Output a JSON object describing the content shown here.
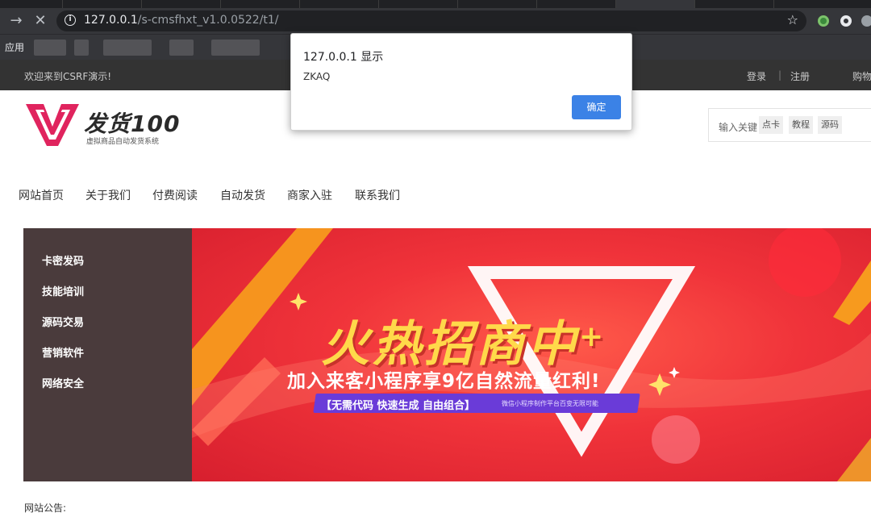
{
  "browser": {
    "url_host": "127.0.0.1",
    "url_path": "/s-cmsfhxt_v1.0.0522/t1/",
    "bookmarks_apps_label": "应用"
  },
  "topbar": {
    "welcome": "欢迎来到CSRF演示!",
    "login": "登录",
    "separator": "|",
    "register": "注册",
    "cart": "购物"
  },
  "header": {
    "logo_text": "发货100",
    "logo_subtitle": "虚拟商品自动发货系统",
    "search_placeholder": "输入关键",
    "search_tags": [
      "点卡",
      "教程",
      "源码"
    ]
  },
  "nav": {
    "items": [
      "网站首页",
      "关于我们",
      "付费阅读",
      "自动发货",
      "商家入驻",
      "联系我们"
    ]
  },
  "sidebar": {
    "categories": [
      "卡密发码",
      "技能培训",
      "源码交易",
      "营销软件",
      "网络安全"
    ]
  },
  "banner": {
    "headline": "火热招商中",
    "plus": "+",
    "subline": "加入来客小程序享9亿自然流量红利!",
    "pill_main": "【无需代码  快速生成  自由组合】",
    "pill_small": "微信小程序制作平台百变无限可能"
  },
  "notice": {
    "label": "网站公告:"
  },
  "dialog": {
    "title": "127.0.0.1 显示",
    "message": "ZKAQ",
    "ok_label": "确定"
  },
  "colors": {
    "dialog_button": "#3b82e6",
    "topbar_bg": "#333333",
    "sidebar_bg": "#4a3b3c",
    "banner_red": "#f0333a",
    "headline_yellow": "#ffd94a",
    "logo_pink": "#e0245e"
  }
}
